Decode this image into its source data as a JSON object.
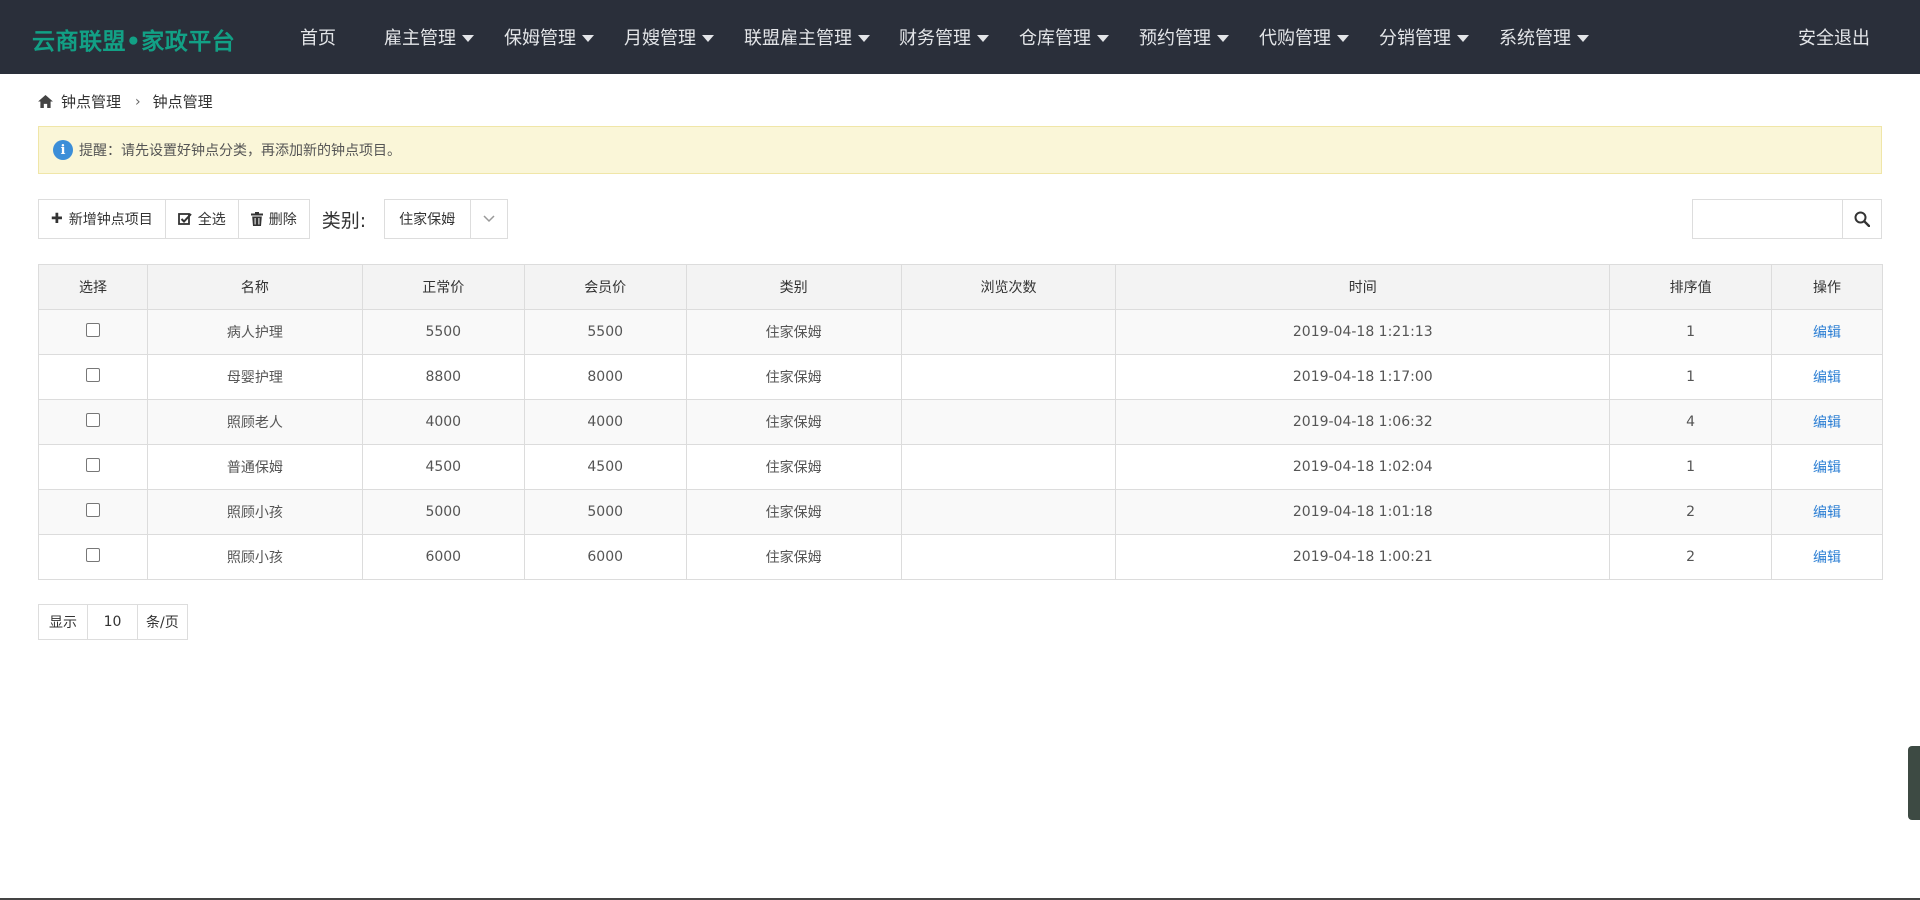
{
  "header": {
    "brand": "云商联盟•家政平台",
    "nav": [
      {
        "label": "首页"
      },
      {
        "label": "雇主管理"
      },
      {
        "label": "保姆管理"
      },
      {
        "label": "月嫂管理"
      },
      {
        "label": "联盟雇主管理"
      },
      {
        "label": "财务管理"
      },
      {
        "label": "仓库管理"
      },
      {
        "label": "预约管理"
      },
      {
        "label": "代购管理"
      },
      {
        "label": "分销管理"
      },
      {
        "label": "系统管理"
      }
    ],
    "logout": "安全退出"
  },
  "breadcrumb": [
    "钟点管理",
    "钟点管理"
  ],
  "alert": {
    "text": "提醒：请先设置好钟点分类，再添加新的钟点项目。"
  },
  "toolbar": {
    "add_label": "新增钟点项目",
    "select_all_label": "全选",
    "delete_label": "删除",
    "category_label": "类别:",
    "category_value": "住家保姆"
  },
  "search": {
    "placeholder": ""
  },
  "table": {
    "headers": [
      "选择",
      "名称",
      "正常价",
      "会员价",
      "类别",
      "浏览次数",
      "时间",
      "排序值",
      "操作"
    ],
    "rows": [
      {
        "name": "病人护理",
        "price": "5500",
        "member_price": "5500",
        "category": "住家保姆",
        "views": "",
        "time": "2019-04-18 1:21:13",
        "sort": "1",
        "action": "编辑"
      },
      {
        "name": "母婴护理",
        "price": "8800",
        "member_price": "8000",
        "category": "住家保姆",
        "views": "",
        "time": "2019-04-18 1:17:00",
        "sort": "1",
        "action": "编辑"
      },
      {
        "name": "照顾老人",
        "price": "4000",
        "member_price": "4000",
        "category": "住家保姆",
        "views": "",
        "time": "2019-04-18 1:06:32",
        "sort": "4",
        "action": "编辑"
      },
      {
        "name": "普通保姆",
        "price": "4500",
        "member_price": "4500",
        "category": "住家保姆",
        "views": "",
        "time": "2019-04-18 1:02:04",
        "sort": "1",
        "action": "编辑"
      },
      {
        "name": "照顾小孩",
        "price": "5000",
        "member_price": "5000",
        "category": "住家保姆",
        "views": "",
        "time": "2019-04-18 1:01:18",
        "sort": "2",
        "action": "编辑"
      },
      {
        "name": "照顾小孩",
        "price": "6000",
        "member_price": "6000",
        "category": "住家保姆",
        "views": "",
        "time": "2019-04-18 1:00:21",
        "sort": "2",
        "action": "编辑"
      }
    ]
  },
  "pager": {
    "prefix": "显示",
    "page_size": "10",
    "suffix": "条/页"
  }
}
